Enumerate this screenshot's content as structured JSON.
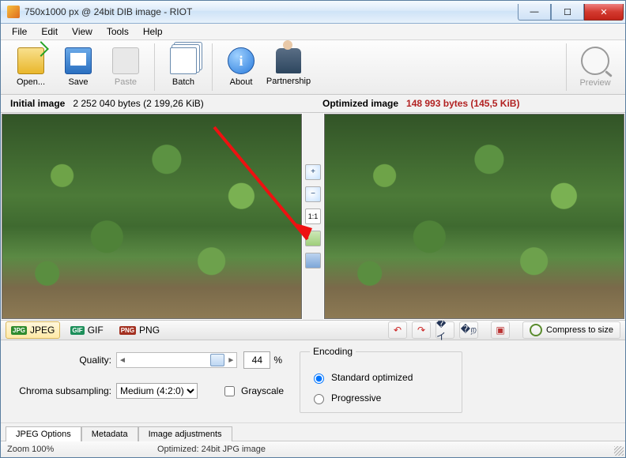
{
  "window": {
    "title": "750x1000 px @ 24bit  DIB image - RIOT"
  },
  "menu": [
    "File",
    "Edit",
    "View",
    "Tools",
    "Help"
  ],
  "toolbar": {
    "open": "Open...",
    "save": "Save",
    "paste": "Paste",
    "batch": "Batch",
    "about": "About",
    "partnership": "Partnership",
    "preview": "Preview"
  },
  "info": {
    "initial_label": "Initial image",
    "initial_size": "2 252 040 bytes (2 199,26 KiB)",
    "optimized_label": "Optimized image",
    "optimized_size": "148 993 bytes (145,5 KiB)"
  },
  "midtools": {
    "ratio": "1:1"
  },
  "formats": {
    "jpeg": "JPEG",
    "gif": "GIF",
    "png": "PNG"
  },
  "actions": {
    "compress": "Compress to size"
  },
  "options": {
    "quality_label": "Quality:",
    "quality_value": "44",
    "quality_percent": "%",
    "chroma_label": "Chroma subsampling:",
    "chroma_value": "Medium (4:2:0)",
    "grayscale": "Grayscale",
    "encoding_legend": "Encoding",
    "enc_standard": "Standard optimized",
    "enc_progressive": "Progressive"
  },
  "bottom_tabs": [
    "JPEG Options",
    "Metadata",
    "Image adjustments"
  ],
  "status": {
    "zoom": "Zoom 100%",
    "optimized": "Optimized: 24bit JPG image"
  }
}
